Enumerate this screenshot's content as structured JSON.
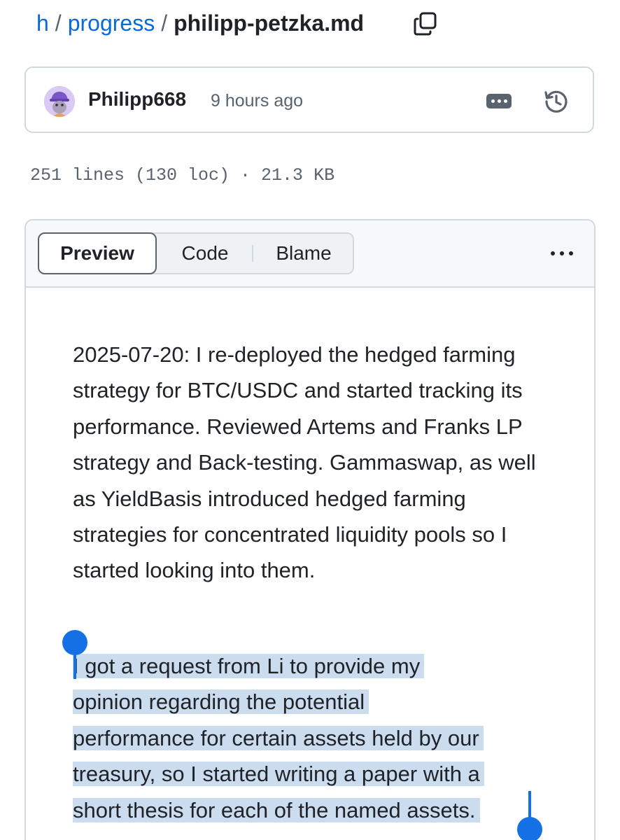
{
  "breadcrumb": {
    "root": "h",
    "separator": "/",
    "folder": "progress",
    "file": "philipp-petzka.md"
  },
  "icons": {
    "copy": "copy-icon",
    "avatar": "avatar-image",
    "more": "kebab-horizontal-icon",
    "history": "history-icon",
    "options": "kebab-horizontal-icon"
  },
  "commit": {
    "author": "Philipp668",
    "time": "9 hours ago"
  },
  "file_info": "251 lines (130 loc) · 21.3 KB",
  "view_tabs": {
    "preview": "Preview",
    "code": "Code",
    "blame": "Blame",
    "selected": "Preview"
  },
  "content": {
    "paragraph1": "2025-07-20: I re-deployed the hedged farming strategy for BTC/USDC and started tracking its performance. Reviewed Artems and Franks LP strategy and Back-testing. Gammaswap, as well as YieldBasis introduced hedged farming strategies for concentrated liquidity pools so I started looking into them.",
    "paragraph2_lines": [
      "I got a request from Li to provide my",
      "opinion regarding the potential",
      "performance for certain assets held by our",
      "treasury, so I started writing a paper with a",
      "short thesis for each of the named assets."
    ]
  },
  "colors": {
    "link": "#0969da",
    "selection": "#cbdcee",
    "selection_handle": "#1570e5",
    "border": "#d1d9e0",
    "muted": "#59636e"
  }
}
